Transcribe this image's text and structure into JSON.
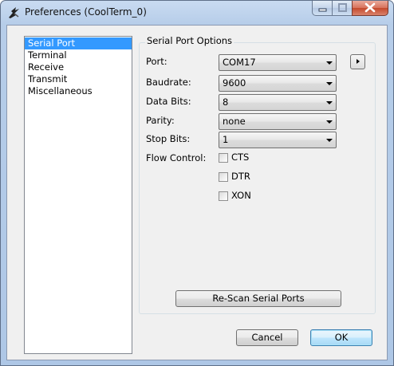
{
  "window": {
    "title": "Preferences (CoolTerm_0)"
  },
  "categories": [
    "Serial Port",
    "Terminal",
    "Receive",
    "Transmit",
    "Miscellaneous"
  ],
  "group_title": "Serial Port Options",
  "port": {
    "label": "Port:",
    "value": "COM17"
  },
  "baudrate": {
    "label": "Baudrate:",
    "value": "9600"
  },
  "data_bits": {
    "label": "Data Bits:",
    "value": "8"
  },
  "parity": {
    "label": "Parity:",
    "value": "none"
  },
  "stop_bits": {
    "label": "Stop Bits:",
    "value": "1"
  },
  "flow_control": {
    "label": "Flow Control:",
    "options": [
      {
        "label": "CTS",
        "checked": false
      },
      {
        "label": "DTR",
        "checked": false
      },
      {
        "label": "XON",
        "checked": false
      }
    ]
  },
  "rescan_label": "Re-Scan Serial Ports",
  "cancel_label": "Cancel",
  "ok_label": "OK"
}
